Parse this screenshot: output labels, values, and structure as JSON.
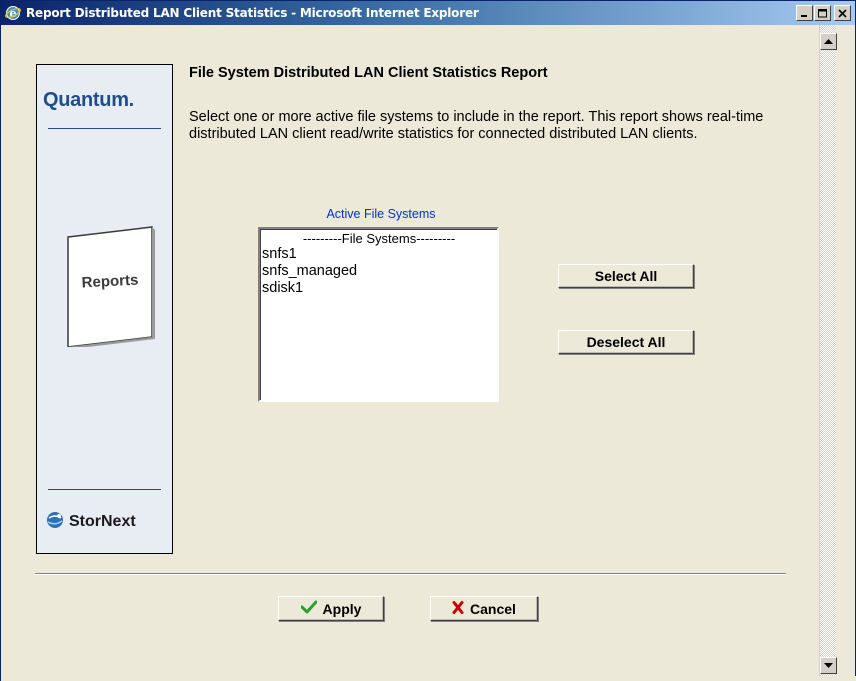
{
  "window": {
    "title": "Report Distributed LAN Client Statistics - Microsoft Internet Explorer",
    "minimize": "_",
    "maximize": "□",
    "close": "×"
  },
  "brand": {
    "logo_text": "Quantum.",
    "card_label": "Reports",
    "product_text": "StorNext"
  },
  "report": {
    "title": "File System Distributed LAN Client Statistics Report",
    "description": "Select one or more active file systems to include in the report. This report shows real-time distributed LAN client read/write statistics for connected distributed LAN clients."
  },
  "file_systems": {
    "label": "Active File Systems",
    "header": "---------File Systems---------",
    "items": [
      "snfs1",
      "snfs_managed",
      "sdisk1"
    ]
  },
  "buttons": {
    "select_all": "Select All",
    "deselect_all": "Deselect All",
    "apply": "Apply",
    "cancel": "Cancel"
  },
  "colors": {
    "titlebar_start": "#0a246a",
    "link_blue": "#0033cc",
    "brand_blue": "#1f4e8c",
    "apply_check": "#2e9e2e",
    "cancel_x": "#cc0000"
  },
  "icons": {
    "window": "internet-explorer-icon",
    "apply": "checkmark-icon",
    "cancel": "x-icon",
    "stornext": "stornext-globe-icon",
    "scroll_up": "arrow-up-icon",
    "scroll_down": "arrow-down-icon"
  }
}
